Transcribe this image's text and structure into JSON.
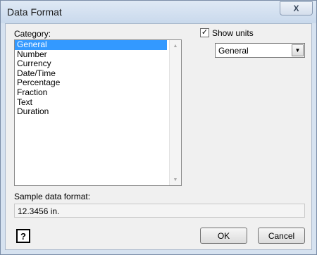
{
  "window": {
    "title": "Data Format",
    "close_label": "X"
  },
  "category": {
    "label": "Category:",
    "items": [
      "General",
      "Number",
      "Currency",
      "Date/Time",
      "Percentage",
      "Fraction",
      "Text",
      "Duration"
    ],
    "selected": "General"
  },
  "show_units": {
    "label": "Show units",
    "checked": true,
    "check_glyph": "✓"
  },
  "units_select": {
    "value": "General",
    "arrow": "▼"
  },
  "sample": {
    "label": "Sample data format:",
    "value": "12.3456 in."
  },
  "buttons": {
    "help": "?",
    "ok": "OK",
    "cancel": "Cancel"
  },
  "scrollbar": {
    "up": "▲",
    "down": "▼"
  },
  "colors": {
    "selection": "#3399ff",
    "frame": "#d6e2f0",
    "client": "#f0f0f0"
  },
  "icons": {
    "help": "help-icon",
    "close": "close-icon",
    "dropdown": "chevron-down-icon"
  }
}
